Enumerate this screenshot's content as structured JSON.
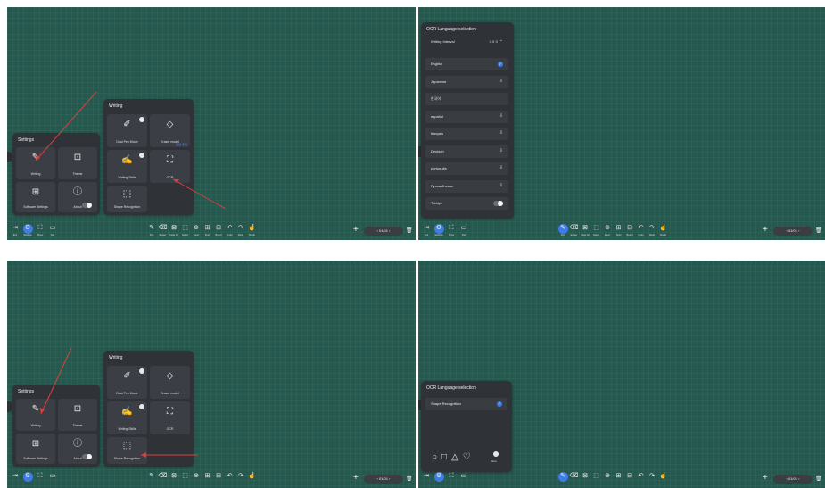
{
  "toolbar_left": {
    "items": [
      {
        "icon": "exit-icon",
        "glyph": "⇥",
        "label": "Exit"
      },
      {
        "icon": "gear-icon",
        "glyph": "⚙",
        "label": "Settings"
      },
      {
        "icon": "show-icon",
        "glyph": "⛶",
        "label": "Show"
      },
      {
        "icon": "file-icon",
        "glyph": "▭",
        "label": "File"
      }
    ]
  },
  "toolbar_center": {
    "items": [
      {
        "icon": "pen-icon",
        "glyph": "✎",
        "label": "Pen"
      },
      {
        "icon": "eraser-icon",
        "glyph": "⌫",
        "label": "Eraser"
      },
      {
        "icon": "clear-all-icon",
        "glyph": "⊠",
        "label": "Clear All"
      },
      {
        "icon": "select-icon",
        "glyph": "⬚",
        "label": "Select"
      },
      {
        "icon": "insert-icon",
        "glyph": "⊕",
        "label": "Insert"
      },
      {
        "icon": "tools-icon",
        "glyph": "⊞",
        "label": "Tools"
      },
      {
        "icon": "board-icon",
        "glyph": "⊟",
        "label": "Board"
      },
      {
        "icon": "undo-icon",
        "glyph": "↶",
        "label": "Undo"
      },
      {
        "icon": "redo-icon",
        "glyph": "↷",
        "label": "Redo"
      },
      {
        "icon": "hand-icon",
        "glyph": "☝",
        "label": "Single"
      }
    ]
  },
  "pager": {
    "text": "01/01",
    "prev": "‹",
    "next": "›",
    "add": "+",
    "trash": "🗑"
  },
  "settings_panel": {
    "title": "Settings",
    "cells": [
      {
        "icon": "writing-icon",
        "glyph": "✎",
        "label": "Writing"
      },
      {
        "icon": "theme-icon",
        "glyph": "⊡",
        "label": "Theme"
      },
      {
        "icon": "software-settings-icon",
        "glyph": "⊞",
        "label": "Software Settings"
      },
      {
        "icon": "info-icon",
        "glyph": "ⓘ",
        "label": "About"
      }
    ]
  },
  "writing_panel": {
    "title": "Writing",
    "cells": [
      {
        "icon": "dual-pen-icon",
        "glyph": "✐",
        "label": "Dual Pen Mode"
      },
      {
        "icon": "eraser-model-icon",
        "glyph": "◇",
        "label": "Eraser model"
      },
      {
        "icon": "writing-skills-icon",
        "glyph": "✍",
        "label": "Writing Skills"
      },
      {
        "icon": "ocr-icon",
        "glyph": "⛶",
        "label": "OCR"
      },
      {
        "icon": "shape-recognition-icon",
        "glyph": "⬚",
        "label": "Shape Recognition"
      }
    ],
    "eraser_hint": "自动 手动"
  },
  "ocr_panel": {
    "title": "OCR Language selection",
    "interval_label": "Writing Interval",
    "interval_value": "0.5 S",
    "languages": [
      {
        "name": "English",
        "state": "checked"
      },
      {
        "name": "Japanese",
        "state": "download"
      },
      {
        "name": "한국어",
        "state": ""
      },
      {
        "name": "español",
        "state": "download"
      },
      {
        "name": "français",
        "state": "download"
      },
      {
        "name": "Deutsch",
        "state": "download"
      },
      {
        "name": "português",
        "state": "download"
      },
      {
        "name": "Русский язык",
        "state": "download"
      },
      {
        "name": "Türkiye",
        "state": "toggle"
      }
    ]
  },
  "shape_panel": {
    "title": "OCR Language selection",
    "option": "Shape Recognition",
    "shapes": [
      "○",
      "□",
      "△",
      "♡"
    ],
    "more_label": "More"
  },
  "colors": {
    "canvas": "#25594f",
    "panel": "#2f3237",
    "cell": "#3b3e44",
    "accent": "#3d7de8",
    "arrow": "#d9413b"
  }
}
